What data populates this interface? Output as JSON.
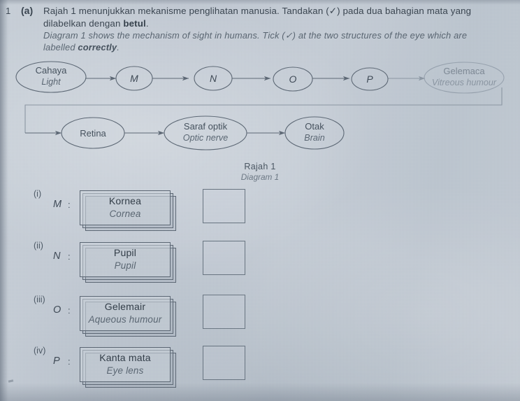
{
  "question": {
    "number": "1",
    "part": "(a)",
    "malay_line1": "Rajah 1 menunjukkan mekanisme penglihatan manusia. Tandakan (✓) pada dua bahagian mata yang",
    "malay_line2_pre": "dilabelkan dengan ",
    "malay_line2_bold": "betul",
    "malay_line2_post": ".",
    "english_line1": "Diagram 1 shows the mechanism of sight in humans. Tick (✓) at the two structures of the eye which are",
    "english_line2_pre": "labelled ",
    "english_line2_bold": "correctly",
    "english_line2_post": "."
  },
  "diagram": {
    "caption_malay": "Rajah 1",
    "caption_english": "Diagram 1",
    "nodes": [
      {
        "id": "light",
        "malay": "Cahaya",
        "english": "Light",
        "faint": false
      },
      {
        "id": "m",
        "letter": "M",
        "faint": false
      },
      {
        "id": "n",
        "letter": "N",
        "faint": false
      },
      {
        "id": "o",
        "letter": "O",
        "faint": false
      },
      {
        "id": "p",
        "letter": "P",
        "faint": false
      },
      {
        "id": "vitreous",
        "malay": "Gelemaca",
        "english": "Vitreous humour",
        "faint": true
      },
      {
        "id": "retina",
        "malay": "Retina",
        "english": "",
        "faint": false
      },
      {
        "id": "optic-nerve",
        "malay": "Saraf optik",
        "english": "Optic nerve",
        "faint": false
      },
      {
        "id": "brain",
        "malay": "Otak",
        "english": "Brain",
        "faint": false
      }
    ]
  },
  "answers": [
    {
      "roman": "(i)",
      "symbol": "M",
      "colon": ":",
      "malay": "Kornea",
      "english": "Cornea",
      "ticked": false
    },
    {
      "roman": "(ii)",
      "symbol": "N",
      "colon": ":",
      "malay": "Pupil",
      "english": "Pupil",
      "ticked": false
    },
    {
      "roman": "(iii)",
      "symbol": "O",
      "colon": ":",
      "malay": "Gelemair",
      "english": "Aqueous humour",
      "ticked": false
    },
    {
      "roman": "(iv)",
      "symbol": "P",
      "colon": ":",
      "malay": "Kanta mata",
      "english": "Eye lens",
      "ticked": false
    }
  ],
  "colors": {
    "paper": "#c3cbd4",
    "ink": "#3a4550",
    "ink_english": "#5a6672",
    "ink_faint": "#8b96a2",
    "rule": "#5d6875"
  }
}
